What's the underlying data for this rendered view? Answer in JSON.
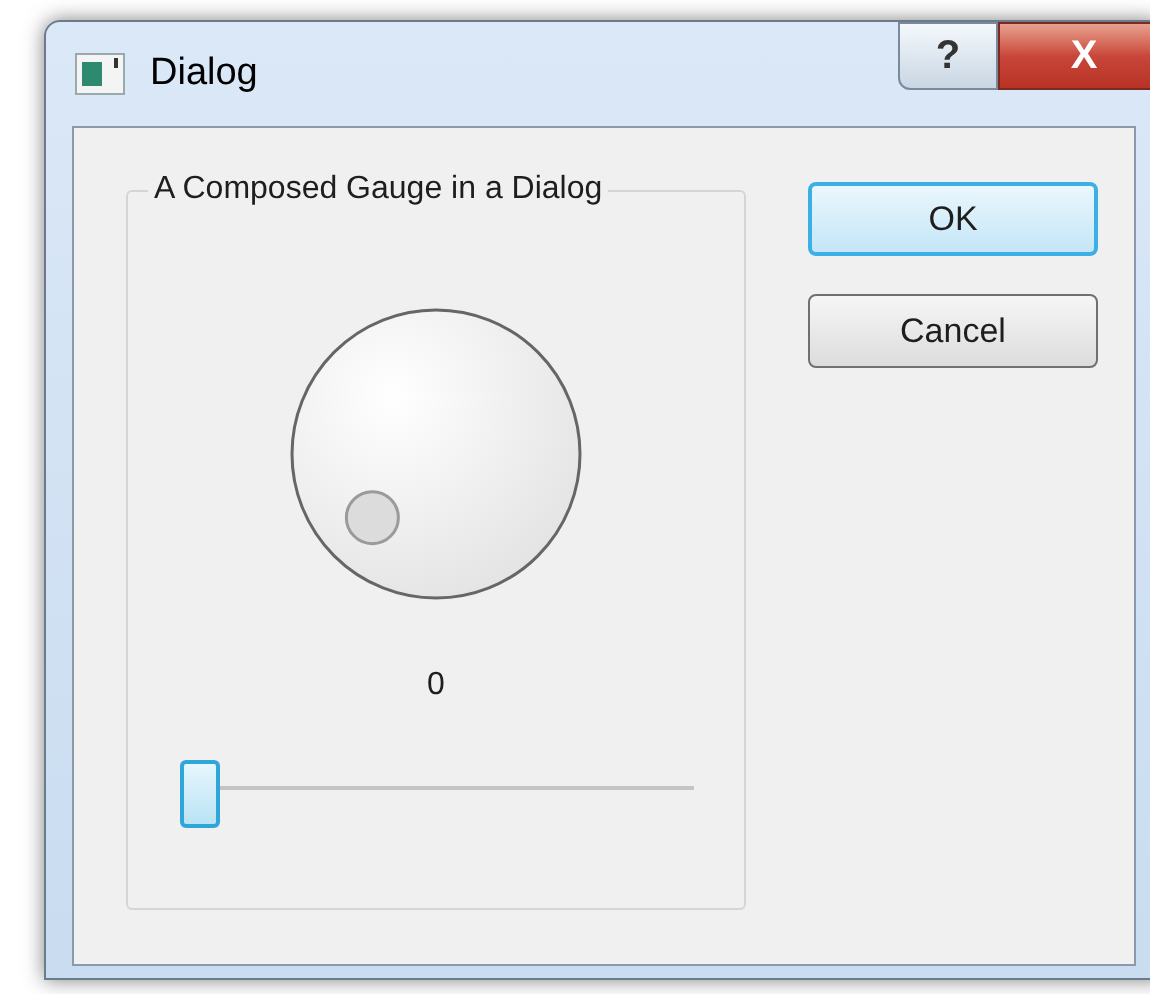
{
  "window": {
    "title": "Dialog",
    "help_button": "?",
    "close_button": "X"
  },
  "group": {
    "title": "A Composed Gauge in a Dialog",
    "value": "0",
    "slider": {
      "level": 0
    }
  },
  "buttons": [
    {
      "label": "OK",
      "default": true
    },
    {
      "label": "Cancel",
      "default": false
    }
  ]
}
